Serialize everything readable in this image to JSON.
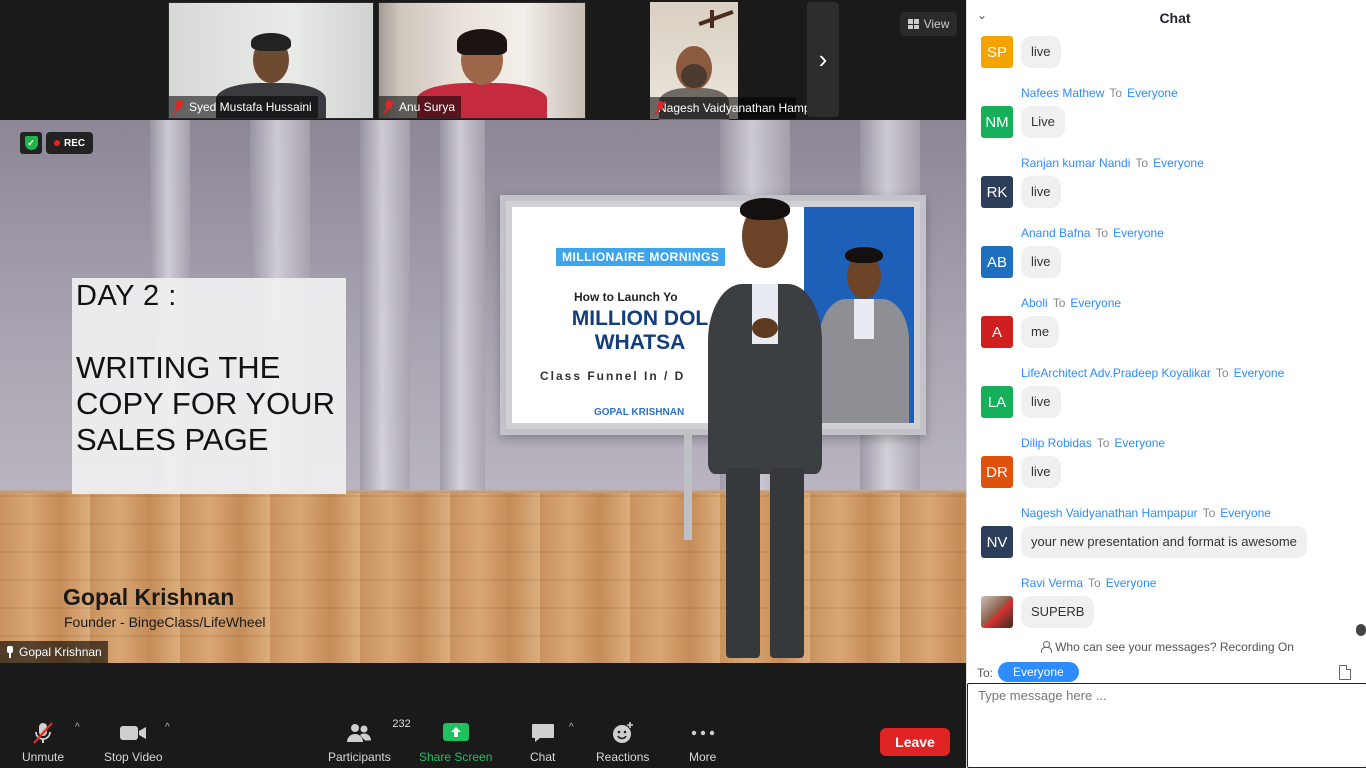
{
  "participants_strip": [
    {
      "name": "Syed Mustafa Hussaini",
      "muted": true
    },
    {
      "name": "Anu Surya",
      "muted": true
    },
    {
      "name": "Nagesh Vaidyanathan Hampap...",
      "muted": true
    }
  ],
  "view_button": {
    "label": "View"
  },
  "recording": {
    "label": "REC",
    "shield_glyph": "✓"
  },
  "slide": {
    "day": "DAY 2 :",
    "body": "WRITING THE COPY FOR YOUR SALES PAGE",
    "presenter_name": "Gopal Krishnan",
    "presenter_title": "Founder - BingeClass/LifeWheel",
    "board_tag": "MILLIONAIRE MORNINGS",
    "board_how": "How to Launch Yo",
    "board_headline": "MILLION DOL WHATSA",
    "board_funnel": "Class Funnel In / D",
    "board_author": "GOPAL KRISHNAN"
  },
  "active_speaker": "Gopal Krishnan",
  "toolbar": {
    "unmute": "Unmute",
    "stop_video": "Stop Video",
    "participants": "Participants",
    "participants_count": "232",
    "share_screen": "Share Screen",
    "chat": "Chat",
    "reactions": "Reactions",
    "more": "More",
    "leave": "Leave"
  },
  "chat": {
    "title": "Chat",
    "to_word": "To",
    "messages": [
      {
        "initials": "SP",
        "color": "#f4a300",
        "sender": "",
        "recipient": "",
        "text": "live"
      },
      {
        "initials": "NM",
        "color": "#16b05a",
        "sender": "Nafees Mathew",
        "recipient": "Everyone",
        "text": "Live"
      },
      {
        "initials": "RK",
        "color": "#2c3e5a",
        "sender": "Ranjan kumar Nandi",
        "recipient": "Everyone",
        "text": "live"
      },
      {
        "initials": "AB",
        "color": "#1f6fbf",
        "sender": "Anand Bafna",
        "recipient": "Everyone",
        "text": "live"
      },
      {
        "initials": "A",
        "color": "#cf1f1f",
        "sender": "Aboli",
        "recipient": "Everyone",
        "text": "me"
      },
      {
        "initials": "LA",
        "color": "#16b05a",
        "sender": "LifeArchitect Adv.Pradeep Koyalikar",
        "recipient": "Everyone",
        "text": "live"
      },
      {
        "initials": "DR",
        "color": "#e0510b",
        "sender": "Dilip Robidas",
        "recipient": "Everyone",
        "text": "live"
      },
      {
        "initials": "NV",
        "color": "#2c3e5a",
        "sender": "Nagesh Vaidyanathan Hampapur",
        "recipient": "Everyone",
        "text": "your new presentation and format is awesome"
      },
      {
        "initials": "",
        "color": "#8a5a44",
        "sender": "Ravi Verma",
        "recipient": "Everyone",
        "text": "SUPERB"
      }
    ],
    "privacy_notice": "Who can see your messages? Recording On",
    "to_label": "To:",
    "to_value": "Everyone",
    "input_placeholder": "Type message here ..."
  }
}
